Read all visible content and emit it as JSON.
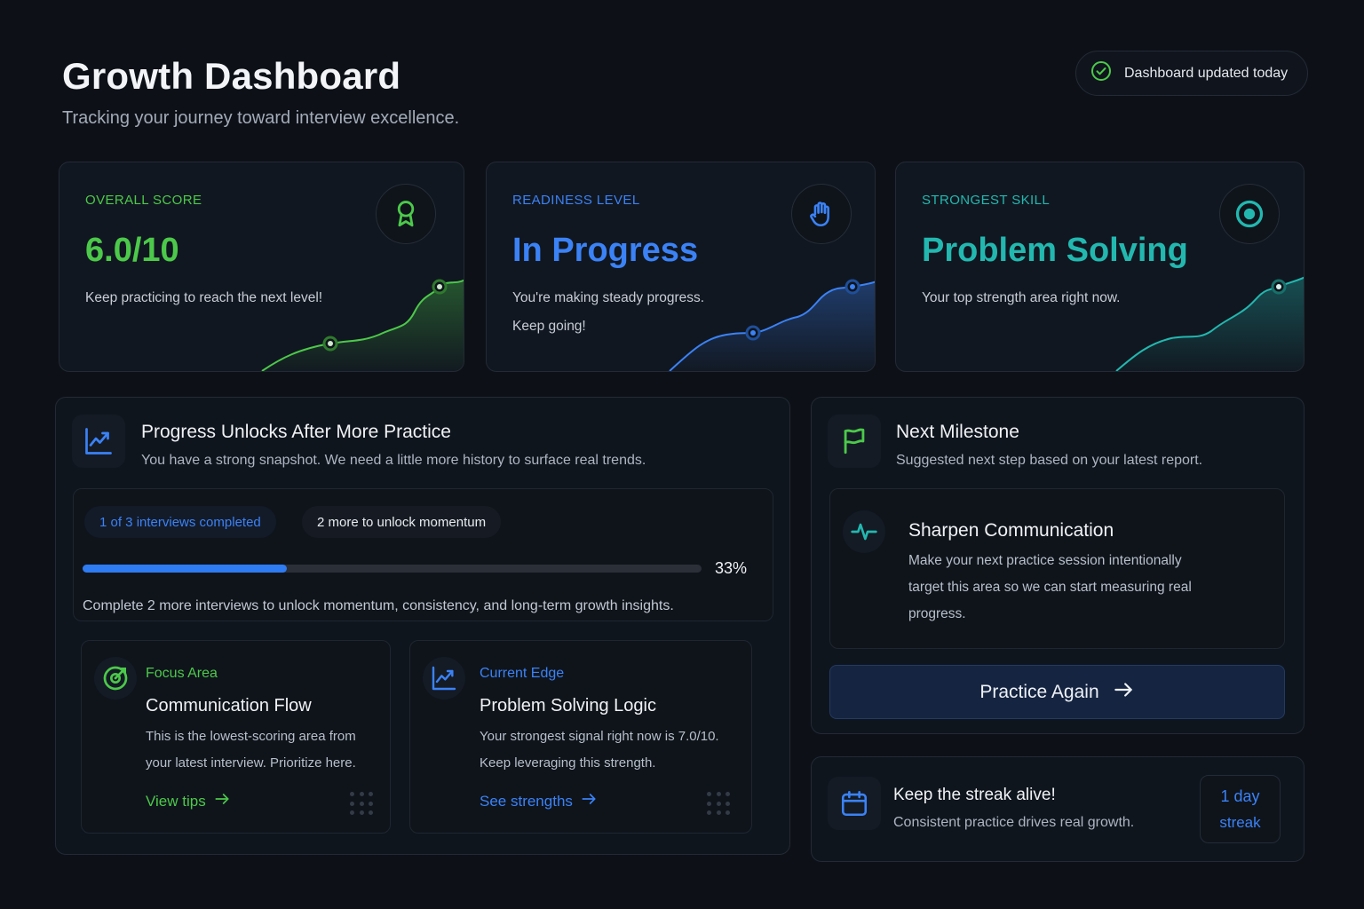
{
  "header": {
    "title": "Growth Dashboard",
    "subtitle": "Tracking your journey toward interview excellence.",
    "status": "Dashboard updated today"
  },
  "stats": [
    {
      "label": "OVERALL SCORE",
      "value": "6.0/10",
      "desc": "Keep practicing to reach the next level!",
      "color": "#4cc94a",
      "icon": "award-ribbon-icon"
    },
    {
      "label": "READINESS LEVEL",
      "value": "In Progress",
      "desc": "You're making steady progress. Keep going!",
      "color": "#3b82f6",
      "icon": "hand-icon"
    },
    {
      "label": "STRONGEST SKILL",
      "value": "Problem Solving",
      "desc": "Your top strength area right now.",
      "color": "#22b8b0",
      "icon": "target-icon"
    }
  ],
  "progress": {
    "title": "Progress Unlocks After More Practice",
    "subtitle": "You have a strong snapshot. We need a little more history to surface real trends.",
    "chip_completed": "1 of 3 interviews completed",
    "chip_remaining": "2 more to unlock momentum",
    "percent_label": "33%",
    "percent_value": 0.33,
    "note": "Complete 2 more interviews to unlock momentum, consistency, and long-term growth insights.",
    "focus": {
      "label": "Focus Area",
      "title": "Communication Flow",
      "text": "This is the lowest-scoring area from your latest interview. Prioritize here.",
      "link": "View tips"
    },
    "edge": {
      "label": "Current Edge",
      "title": "Problem Solving Logic",
      "text": "Your strongest signal right now is 7.0/10. Keep leveraging this strength.",
      "link": "See strengths"
    }
  },
  "milestone": {
    "title": "Next Milestone",
    "subtitle": "Suggested next step based on your latest report.",
    "item_title": "Sharpen Communication",
    "item_text": "Make your next practice session intentionally target this area so we can start measuring real progress.",
    "button": "Practice Again"
  },
  "streak": {
    "title": "Keep the streak alive!",
    "subtitle": "Consistent practice drives real growth.",
    "count": "1 day",
    "unit": "streak"
  },
  "colors": {
    "green": "#4cc94a",
    "blue": "#3b82f6",
    "teal": "#22b8b0",
    "background": "#0d1117"
  }
}
